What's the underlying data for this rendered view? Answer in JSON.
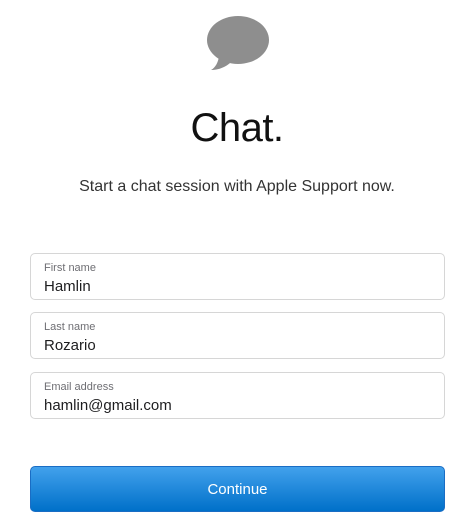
{
  "header": {
    "icon": "chat-bubble-icon",
    "title": "Chat.",
    "subtitle": "Start a chat session with Apple Support now."
  },
  "form": {
    "first_name": {
      "label": "First name",
      "value": "Hamlin"
    },
    "last_name": {
      "label": "Last name",
      "value": "Rozario"
    },
    "email": {
      "label": "Email address",
      "value": "hamlin@gmail.com"
    }
  },
  "actions": {
    "continue_label": "Continue"
  },
  "colors": {
    "icon_gray": "#8e8e8e",
    "button_top": "#42a1ec",
    "button_bottom": "#0070c9",
    "field_border": "#d6d6d6"
  }
}
